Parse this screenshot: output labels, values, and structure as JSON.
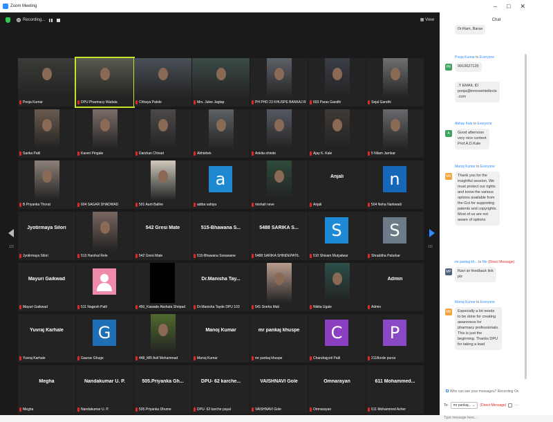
{
  "window": {
    "title": "Zoom Meeting",
    "controls": [
      "–",
      "□",
      "✕"
    ]
  },
  "topbar": {
    "recording": "Recording...",
    "view": "View"
  },
  "pages": {
    "left": "1/2",
    "right": "1/2"
  },
  "tiles": [
    {
      "name": "Pooja Kumar",
      "kind": "photo",
      "bg": "#3b3b38"
    },
    {
      "name": "DPU Pharmacy Wadala",
      "kind": "photo",
      "bg": "#5b5a4f",
      "highlight": true
    },
    {
      "name": "Chhaya Patole",
      "kind": "photo",
      "bg": "#4a5057"
    },
    {
      "name": "Mrs. Julee Jagtap",
      "kind": "photo",
      "bg": "#3c4b47"
    },
    {
      "name": "PH PHD 23 KHUSPE BANKAJ R...",
      "kind": "photo",
      "bg": "#5c6167"
    },
    {
      "name": "603 Paras Gandhi",
      "kind": "photo",
      "bg": "#3a3e45"
    },
    {
      "name": "Sejal Gandhi",
      "kind": "photo",
      "bg": "#6e6f70"
    },
    {
      "name": "Sarika Patil",
      "kind": "photo",
      "bg": "#6a5a4f"
    },
    {
      "name": "Kaveri Pingale",
      "kind": "photo",
      "bg": "#7c6c6a"
    },
    {
      "name": "Darshan Chivad",
      "kind": "photo",
      "bg": "#4d4949"
    },
    {
      "name": "Abhishek",
      "kind": "photo",
      "bg": "#5d6064"
    },
    {
      "name": "Ankita shinde",
      "kind": "photo",
      "bg": "#555a62"
    },
    {
      "name": "Ajay K. Kale",
      "kind": "photo",
      "bg": "#3f3a36"
    },
    {
      "name": "5 Nilam Jambar",
      "kind": "photo",
      "bg": "#67696c"
    },
    {
      "name": "B Priyanka Thorat",
      "kind": "photo",
      "bg": "#8c817a"
    },
    {
      "name": "604 SAGAR DHADWAD",
      "kind": "empty"
    },
    {
      "name": "501 Aarti Ballire",
      "kind": "photo",
      "bg": "#cfc9bd"
    },
    {
      "name": "adiba sahiya",
      "kind": "letter",
      "letter": "a",
      "color": "#1e88d0"
    },
    {
      "name": "mishali neve",
      "kind": "photo",
      "bg": "#2e4a3a"
    },
    {
      "name": "Anjali",
      "kind": "bigname",
      "big": "Anjali"
    },
    {
      "name": "504 Neha Narkwadi",
      "kind": "letter",
      "letter": "n",
      "color": "#1667b8"
    },
    {
      "name": "Jyotirmaya Silori",
      "kind": "bigname",
      "big": "Jyotirmaya Silori"
    },
    {
      "name": "513 Harshal Rele",
      "kind": "photo",
      "bg": "#7a6660"
    },
    {
      "name": "542 Gresi Mate",
      "kind": "bigname",
      "big": "542 Gresi Mate"
    },
    {
      "name": "515-Bhawana Sonawane",
      "kind": "bigname",
      "big": "515-Bhawana S..."
    },
    {
      "name": "5488 SARIKA SHINDEPATIL",
      "kind": "bigname",
      "big": "5488 SARIKA S..."
    },
    {
      "name": "510 Shivam Mutyalwar",
      "kind": "letter",
      "letter": "S",
      "color": "#1e8ad6"
    },
    {
      "name": "Shraddha Paturkar",
      "kind": "letter",
      "letter": "S",
      "color": "#6c7b87"
    },
    {
      "name": "Mayuri Gaikwad",
      "kind": "bigname",
      "big": "Mayuri Gaikwad"
    },
    {
      "name": "511 Nagesh Patil",
      "kind": "pinkavatar"
    },
    {
      "name": "450_Kawade Akshata Shripad",
      "kind": "black"
    },
    {
      "name": "Dr.Manisha Tayde DPU 103",
      "kind": "bigname",
      "big": "Dr.Manisha Tay..."
    },
    {
      "name": "541 Sneha Mali",
      "kind": "photo",
      "bg": "#b99c8e"
    },
    {
      "name": "Nikita Ugale",
      "kind": "photo",
      "bg": "#2c4f4a"
    },
    {
      "name": "Admin",
      "kind": "bigname",
      "big": "Admin"
    },
    {
      "name": "Yuvraj Karhale",
      "kind": "bigname",
      "big": "Yuvraj Karhale"
    },
    {
      "name": "Gaurav Ghuge",
      "kind": "letter",
      "letter": "G",
      "color": "#1e6fb5"
    },
    {
      "name": "448_MR Asif Mohammad",
      "kind": "photo",
      "bg": "#4f6a2e"
    },
    {
      "name": "Manoj Kumar",
      "kind": "bigname",
      "big": "Manoj Kumar"
    },
    {
      "name": "mr pankaj khuspe",
      "kind": "bigname",
      "big": "mr pankaj khuspe"
    },
    {
      "name": "Chandrajyoti Patil",
      "kind": "letter",
      "letter": "C",
      "color": "#8b3fc1"
    },
    {
      "name": "211Borde purva",
      "kind": "letter",
      "letter": "P",
      "color": "#8a49c4"
    },
    {
      "name": "Megha",
      "kind": "bigname",
      "big": "Megha"
    },
    {
      "name": "Nandakumar U. P.",
      "kind": "bigname",
      "big": "Nandakumar U. P."
    },
    {
      "name": "505.Priyanka Dhume",
      "kind": "bigname",
      "big": "505.Priyanka Gh..."
    },
    {
      "name": "DPU- 62 karche payal",
      "kind": "bigname",
      "big": "DPU- 62 karche..."
    },
    {
      "name": "VAISHNAVI Gole",
      "kind": "bigname",
      "big": "VAISHNAVI Gole"
    },
    {
      "name": "Omnarayan",
      "kind": "bigname",
      "big": "Omnarayan"
    },
    {
      "name": "611 Mohammed Azher",
      "kind": "bigname",
      "big": "611 Mohammed..."
    }
  ],
  "chat": {
    "title": "Chat",
    "messages": [
      {
        "from": "",
        "to": "",
        "initials": "",
        "avcolor": "",
        "lines": [
          "Dr.Ram, Barae"
        ],
        "partial": true
      },
      {
        "from": "Pooja Kumar",
        "to": "Everyone",
        "initials": "PK",
        "avcolor": "#3fa35e",
        "lines": [
          "9910627125"
        ]
      },
      {
        "from": "",
        "to": "",
        "initials": "",
        "avcolor": "",
        "lines": [
          ",Y EMAIL ID",
          "pooja@innoveintellects",
          ".com"
        ]
      },
      {
        "from": "Abhay Kale",
        "to": "Everyone",
        "initials": "A",
        "avcolor": "#3fa35e",
        "lines": [
          "Good afternoon",
          "very nice content",
          "Prof.A.D.Kale"
        ]
      },
      {
        "from": "Manoj Kumar",
        "to": "Everyone",
        "initials": "MK",
        "avcolor": "#f2a33c",
        "lines": [
          "Thank you for the",
          "insightful session. We",
          "must protect our rights",
          "and know the various",
          "options available from",
          "the GoI for supporting",
          "patents and copyrights.",
          "Most of us are not",
          "aware of options"
        ]
      },
      {
        "from": "mr pankaj kh...",
        "to": "Me",
        "dm": "(Direct Message)",
        "initials": "MP",
        "avcolor": "#4a5f7a",
        "lines": [
          "Ravi sir feedback link",
          "plz"
        ]
      },
      {
        "from": "Manoj Kumar",
        "to": "Everyone",
        "initials": "MK",
        "avcolor": "#f2a33c",
        "lines": [
          "Especially a lot needs",
          "to be done for creating",
          "awareness for",
          "pharmacy professionals.",
          "This is just the",
          "beginning. Thanks DPU",
          "for taking a lead"
        ]
      }
    ],
    "who_can_see": "Who can see your messages? Recording On",
    "to_label": "To:",
    "to_value": "mr pankaj...",
    "to_dm": "(Direct Message)",
    "placeholder": "Type message here..."
  }
}
